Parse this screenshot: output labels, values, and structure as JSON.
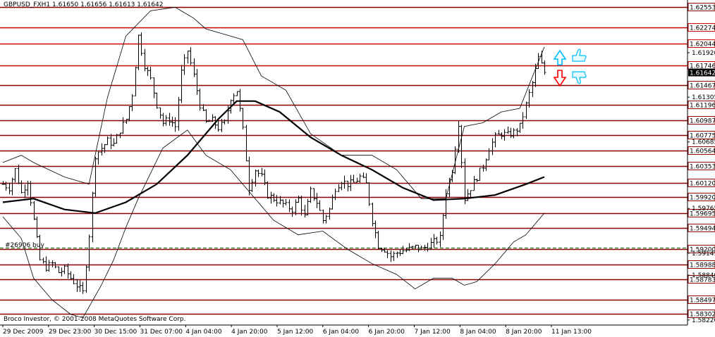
{
  "header": {
    "symbol": "GBPUSD_FXH1",
    "ohlc": "1.61650 1.61656 1.61613 1.61642"
  },
  "copyright": "Broco Investor, © 2001-2008 MetaQuotes Software Corp.",
  "order_label": "#26906",
  "order_side": "buy",
  "colors": {
    "background": "#ffffff",
    "level_line": "#cc0000",
    "level_line_dark": "#8b0000",
    "candle": "#000000",
    "order_line": "#006400",
    "up_arrow": "#00bfff",
    "down_arrow": "#ff0000",
    "thumb": "#00bfff",
    "current_price_box": "#000000"
  },
  "icons": {
    "up_arrow": "hollow-up-arrow-icon",
    "down_arrow": "hollow-down-arrow-icon",
    "thumbs_up": "thumbs-up-icon",
    "thumbs_down": "thumbs-down-icon"
  },
  "chart_data": {
    "type": "candlestick",
    "symbol": "GBPUSD",
    "timeframe": "H1",
    "ylim": [
      1.5815,
      1.6265
    ],
    "current_price": "1.61642",
    "y_ticks": [
      "1.61920",
      "1.61305",
      "1.60685",
      "1.59765",
      "1.59145",
      "1.58840",
      "1.58220"
    ],
    "horizontal_levels": [
      {
        "label": "1.62553",
        "value": 1.62553,
        "style": "dark"
      },
      {
        "label": "1.62274",
        "value": 1.62274,
        "style": "red"
      },
      {
        "label": "1.62044",
        "value": 1.62044,
        "style": "red"
      },
      {
        "label": "1.61746",
        "value": 1.61746,
        "style": "red"
      },
      {
        "label": "1.61467",
        "value": 1.61467,
        "style": "dark"
      },
      {
        "label": "1.61196",
        "value": 1.61196,
        "style": "dark"
      },
      {
        "label": "1.60987",
        "value": 1.60987,
        "style": "dark"
      },
      {
        "label": "1.60775",
        "value": 1.60775,
        "style": "dark"
      },
      {
        "label": "1.60564",
        "value": 1.60564,
        "style": "dark"
      },
      {
        "label": "1.60353",
        "value": 1.60353,
        "style": "dark"
      },
      {
        "label": "1.60120",
        "value": 1.6012,
        "style": "dark"
      },
      {
        "label": "1.59920",
        "value": 1.5992,
        "style": "dark"
      },
      {
        "label": "1.59695",
        "value": 1.59695,
        "style": "dark"
      },
      {
        "label": "1.59494",
        "value": 1.59494,
        "style": "dark"
      },
      {
        "label": "1.59200",
        "value": 1.592,
        "style": "dark"
      },
      {
        "label": "1.58988",
        "value": 1.58988,
        "style": "dark"
      },
      {
        "label": "1.58783",
        "value": 1.58783,
        "style": "dark"
      },
      {
        "label": "1.58497",
        "value": 1.58497,
        "style": "dark"
      },
      {
        "label": "1.58302",
        "value": 1.58302,
        "style": "dark"
      }
    ],
    "order_level": 1.5922,
    "x_tick_labels": [
      "29 Dec 2009",
      "29 Dec 23:00",
      "30 Dec 15:00",
      "31 Dec 07:00",
      "4 Jan 04:00",
      "4 Jan 20:00",
      "5 Jan 12:00",
      "6 Jan 04:00",
      "6 Jan 20:00",
      "7 Jan 12:00",
      "8 Jan 04:00",
      "8 Jan 20:00",
      "11 Jan 13:00"
    ],
    "close_path": [
      [
        0,
        1.601
      ],
      [
        2,
        1.6005
      ],
      [
        4,
        1.603
      ],
      [
        6,
        1.5998
      ],
      [
        8,
        1.6015
      ],
      [
        10,
        1.596
      ],
      [
        12,
        1.5905
      ],
      [
        14,
        1.5895
      ],
      [
        16,
        1.59
      ],
      [
        18,
        1.5888
      ],
      [
        20,
        1.5892
      ],
      [
        22,
        1.588
      ],
      [
        24,
        1.587
      ],
      [
        26,
        1.586
      ],
      [
        28,
        1.594
      ],
      [
        30,
        1.605
      ],
      [
        32,
        1.606
      ],
      [
        34,
        1.607
      ],
      [
        36,
        1.6065
      ],
      [
        38,
        1.6085
      ],
      [
        40,
        1.61
      ],
      [
        42,
        1.6135
      ],
      [
        44,
        1.6215
      ],
      [
        46,
        1.6175
      ],
      [
        48,
        1.6155
      ],
      [
        50,
        1.612
      ],
      [
        52,
        1.6095
      ],
      [
        54,
        1.61
      ],
      [
        56,
        1.609
      ],
      [
        58,
        1.6165
      ],
      [
        60,
        1.6195
      ],
      [
        62,
        1.616
      ],
      [
        64,
        1.612
      ],
      [
        66,
        1.6095
      ],
      [
        68,
        1.6098
      ],
      [
        70,
        1.6088
      ],
      [
        72,
        1.6095
      ],
      [
        74,
        1.613
      ],
      [
        76,
        1.614
      ],
      [
        78,
        1.6085
      ],
      [
        80,
        1.6005
      ],
      [
        82,
        1.603
      ],
      [
        84,
        1.602
      ],
      [
        86,
        1.5995
      ],
      [
        88,
        1.599
      ],
      [
        90,
        1.5985
      ],
      [
        92,
        1.598
      ],
      [
        94,
        1.5975
      ],
      [
        96,
        1.599
      ],
      [
        98,
        1.5965
      ],
      [
        100,
        1.6
      ],
      [
        102,
        1.5985
      ],
      [
        104,
        1.596
      ],
      [
        106,
        1.5975
      ],
      [
        108,
        1.6005
      ],
      [
        110,
        1.6015
      ],
      [
        112,
        1.601
      ],
      [
        114,
        1.6012
      ],
      [
        116,
        1.602
      ],
      [
        118,
        1.601
      ],
      [
        120,
        1.596
      ],
      [
        122,
        1.5925
      ],
      [
        124,
        1.592
      ],
      [
        126,
        1.591
      ],
      [
        128,
        1.5915
      ],
      [
        130,
        1.5918
      ],
      [
        132,
        1.592
      ],
      [
        134,
        1.5923
      ],
      [
        136,
        1.592
      ],
      [
        138,
        1.5925
      ],
      [
        140,
        1.593
      ],
      [
        142,
        1.5935
      ],
      [
        144,
        1.6
      ],
      [
        146,
        1.603
      ],
      [
        148,
        1.6095
      ],
      [
        150,
        1.599
      ],
      [
        152,
        1.6005
      ],
      [
        154,
        1.602
      ],
      [
        156,
        1.6035
      ],
      [
        158,
        1.606
      ],
      [
        160,
        1.6075
      ],
      [
        162,
        1.608
      ],
      [
        164,
        1.6078
      ],
      [
        166,
        1.6082
      ],
      [
        168,
        1.609
      ],
      [
        170,
        1.612
      ],
      [
        172,
        1.615
      ],
      [
        174,
        1.6185
      ],
      [
        176,
        1.6165
      ]
    ],
    "ma_slow": [
      [
        0,
        1.5985
      ],
      [
        10,
        1.599
      ],
      [
        20,
        1.5975
      ],
      [
        30,
        1.597
      ],
      [
        40,
        1.5985
      ],
      [
        50,
        1.601
      ],
      [
        60,
        1.605
      ],
      [
        70,
        1.61
      ],
      [
        76,
        1.6125
      ],
      [
        82,
        1.6125
      ],
      [
        90,
        1.611
      ],
      [
        100,
        1.6075
      ],
      [
        110,
        1.605
      ],
      [
        120,
        1.603
      ],
      [
        130,
        1.6005
      ],
      [
        140,
        1.5988
      ],
      [
        150,
        1.599
      ],
      [
        160,
        1.5995
      ],
      [
        170,
        1.601
      ],
      [
        176,
        1.602
      ]
    ],
    "band_upper": [
      [
        0,
        1.604
      ],
      [
        6,
        1.605
      ],
      [
        10,
        1.604
      ],
      [
        20,
        1.602
      ],
      [
        28,
        1.601
      ],
      [
        34,
        1.613
      ],
      [
        40,
        1.6215
      ],
      [
        48,
        1.625
      ],
      [
        56,
        1.6255
      ],
      [
        62,
        1.624
      ],
      [
        66,
        1.6225
      ],
      [
        74,
        1.6215
      ],
      [
        78,
        1.621
      ],
      [
        84,
        1.616
      ],
      [
        92,
        1.614
      ],
      [
        100,
        1.608
      ],
      [
        110,
        1.605
      ],
      [
        120,
        1.605
      ],
      [
        128,
        1.603
      ],
      [
        136,
        1.599
      ],
      [
        144,
        1.599
      ],
      [
        150,
        1.609
      ],
      [
        156,
        1.6095
      ],
      [
        162,
        1.611
      ],
      [
        168,
        1.6115
      ],
      [
        176,
        1.62
      ]
    ],
    "band_lower": [
      [
        0,
        1.5965
      ],
      [
        6,
        1.5935
      ],
      [
        10,
        1.588
      ],
      [
        16,
        1.585
      ],
      [
        22,
        1.583
      ],
      [
        26,
        1.5825
      ],
      [
        28,
        1.584
      ],
      [
        32,
        1.587
      ],
      [
        36,
        1.5905
      ],
      [
        40,
        1.595
      ],
      [
        44,
        1.599
      ],
      [
        52,
        1.606
      ],
      [
        60,
        1.6085
      ],
      [
        66,
        1.605
      ],
      [
        74,
        1.603
      ],
      [
        80,
        1.6
      ],
      [
        88,
        1.596
      ],
      [
        96,
        1.594
      ],
      [
        104,
        1.5945
      ],
      [
        112,
        1.592
      ],
      [
        120,
        1.59
      ],
      [
        128,
        1.5885
      ],
      [
        134,
        1.5865
      ],
      [
        140,
        1.588
      ],
      [
        146,
        1.588
      ],
      [
        150,
        1.587
      ],
      [
        154,
        1.5875
      ],
      [
        160,
        1.59
      ],
      [
        166,
        1.593
      ],
      [
        170,
        1.594
      ],
      [
        176,
        1.597
      ]
    ]
  }
}
